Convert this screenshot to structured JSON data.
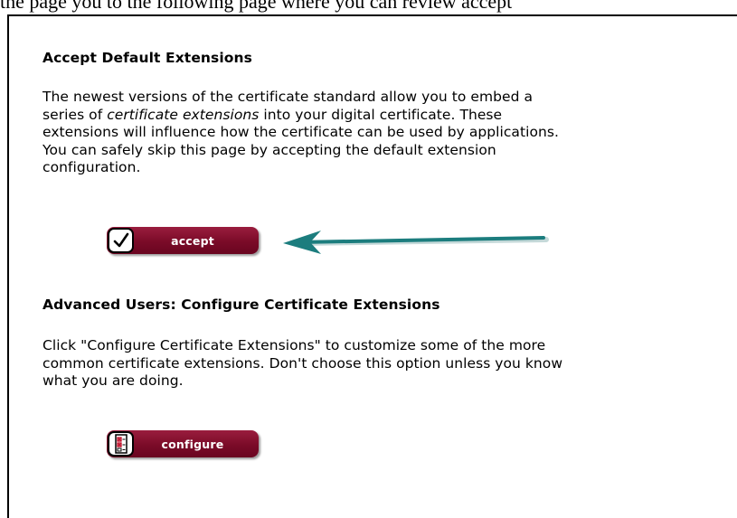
{
  "page": {
    "top_caption": "the page you to the following page where you can review accept"
  },
  "accept_section": {
    "heading": "Accept Default Extensions",
    "para_1": "The newest versions of the certificate standard allow you to embed a",
    "para_2_pre": "series of ",
    "para_2_em": "certificate extensions",
    "para_2_post": " into your digital certificate. These",
    "para_3": "extensions will influence how the certificate can be used by applications.",
    "para_4": "You can safely skip this page by accepting the default extension",
    "para_5": "configuration.",
    "button_label": "accept",
    "button_icon": "checkmark-icon"
  },
  "configure_section": {
    "heading": "Advanced Users: Configure Certificate Extensions",
    "para_1": "Click \"Configure Certificate Extensions\" to customize some of the more",
    "para_2": "common certificate extensions. Don't choose this option unless you know",
    "para_3": "what you are doing.",
    "button_label": "configure",
    "button_icon": "checklist-icon"
  },
  "colors": {
    "button_fill": "#7a0b28",
    "arrow": "#1c7d7e",
    "text": "#000000"
  }
}
